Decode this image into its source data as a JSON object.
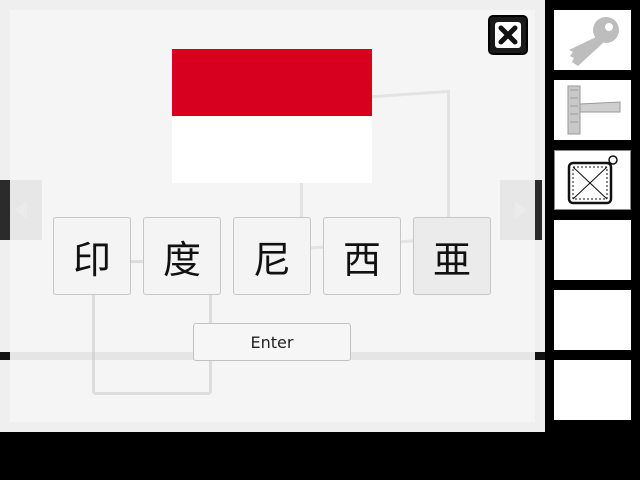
{
  "flag": {
    "colors": {
      "top": "#d7001e",
      "bottom": "#ffffff"
    }
  },
  "puzzle": {
    "characters": [
      "印",
      "度",
      "尼",
      "西",
      "亜"
    ],
    "enter_label": "Enter"
  },
  "close": {
    "icon": "close-icon"
  },
  "inventory": {
    "items": [
      {
        "icon": "key-icon",
        "empty": false,
        "selected": false
      },
      {
        "icon": "squeegee-icon",
        "empty": false,
        "selected": false
      },
      {
        "icon": "pot-holder-icon",
        "empty": false,
        "selected": true
      },
      {
        "icon": "",
        "empty": true,
        "selected": false
      },
      {
        "icon": "",
        "empty": true,
        "selected": false
      },
      {
        "icon": "",
        "empty": true,
        "selected": false
      }
    ]
  },
  "nav": {
    "left_icon": "arrow-left-icon",
    "right_icon": "arrow-right-icon"
  }
}
